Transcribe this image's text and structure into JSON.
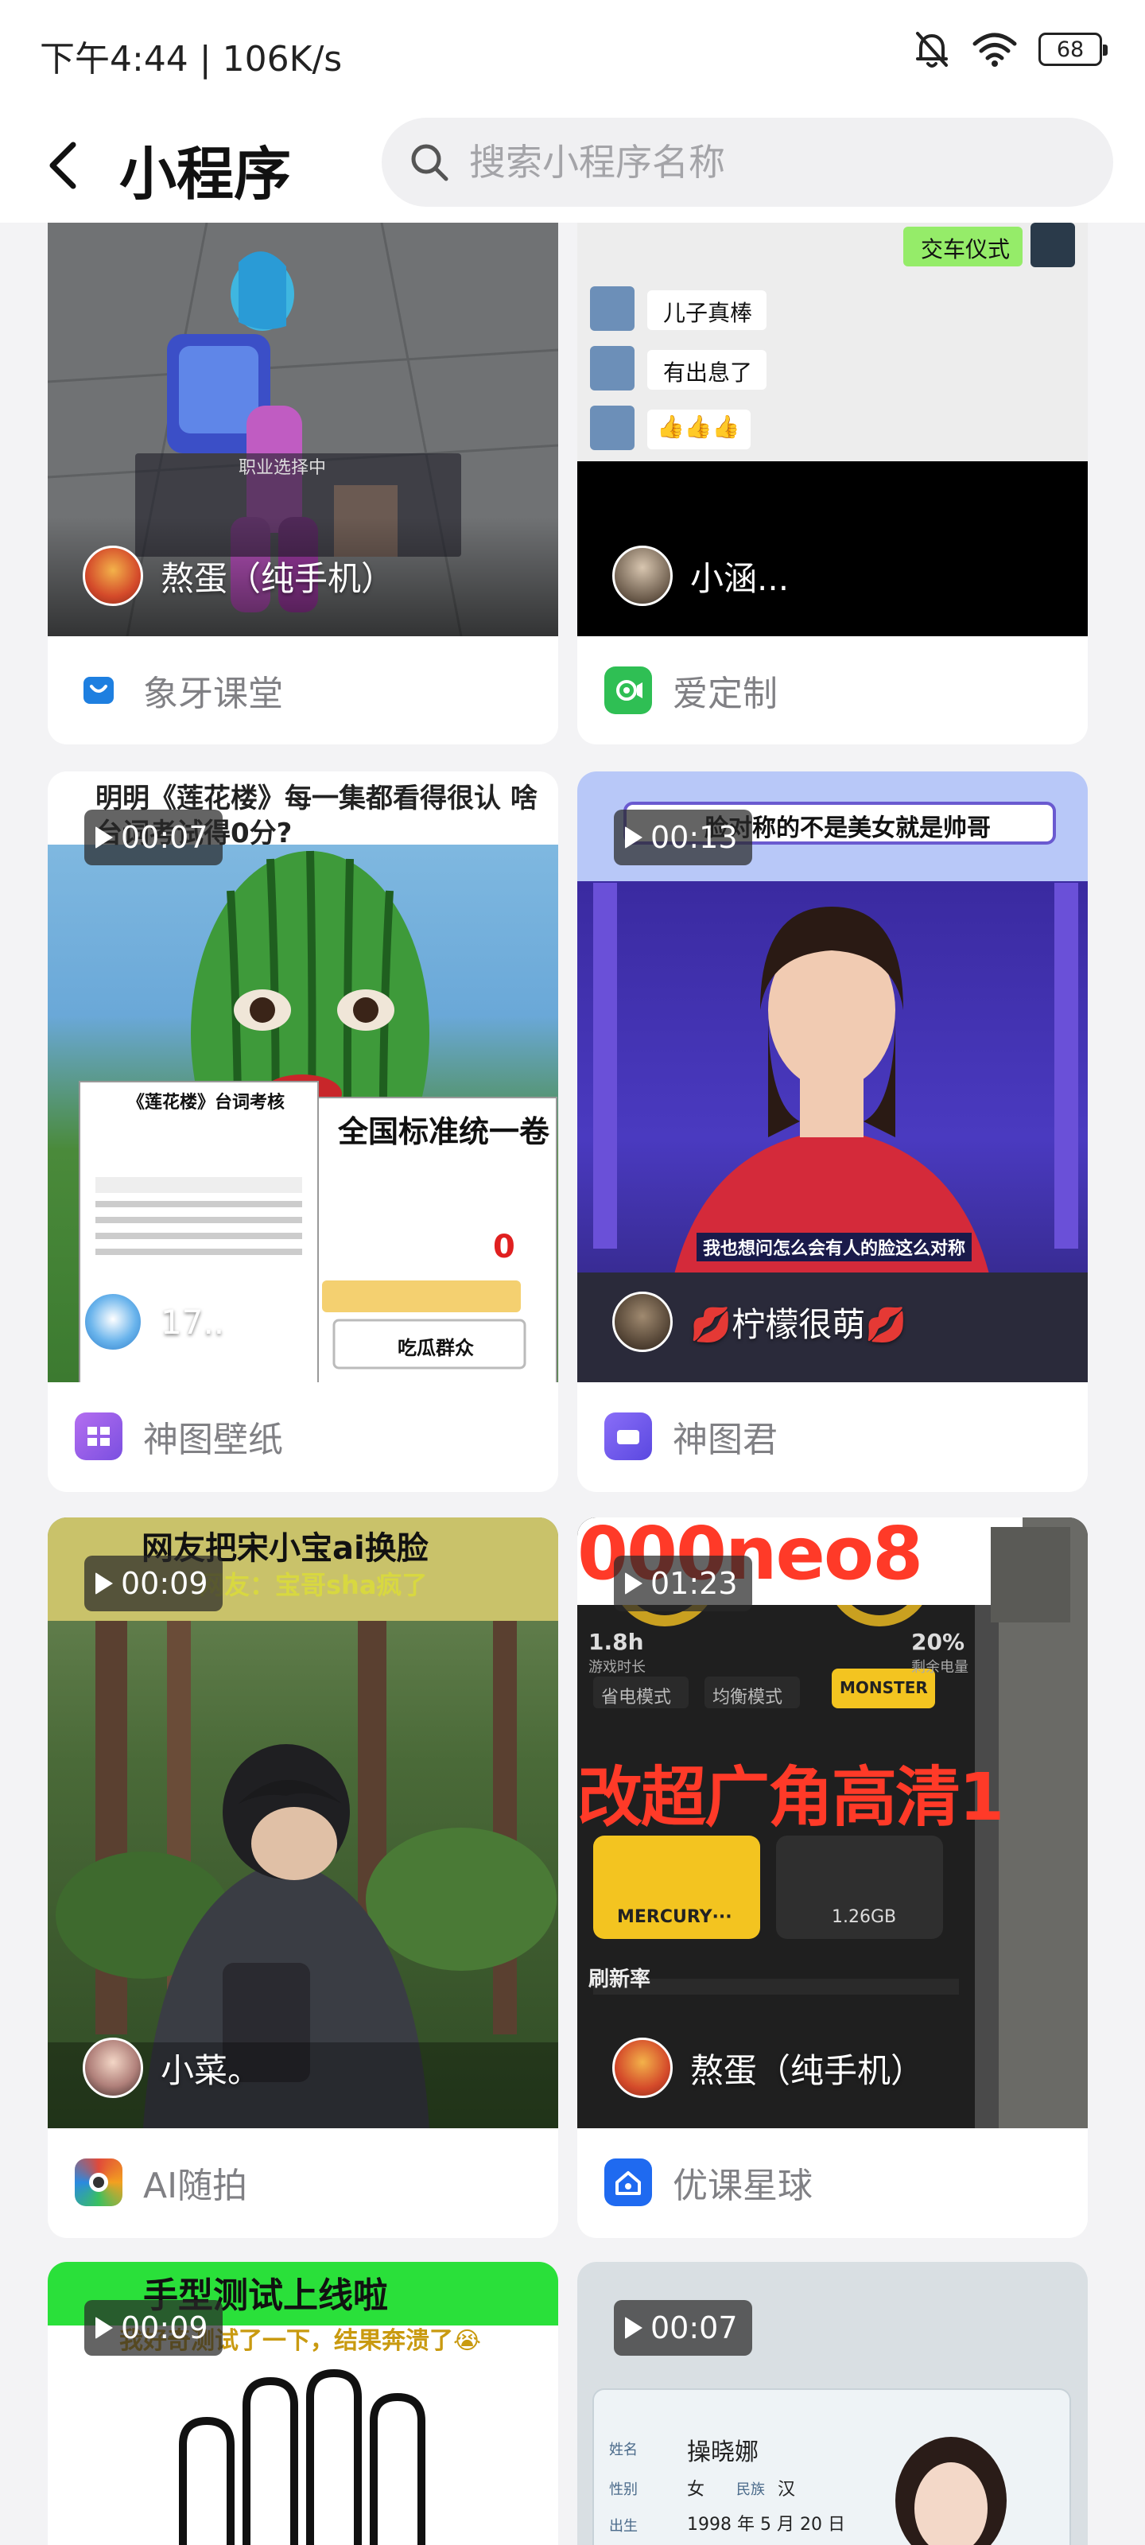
{
  "status_bar": {
    "time": "下午4:44 | 106K/s",
    "battery": "68"
  },
  "header": {
    "title": "小程序",
    "search_placeholder": "搜索小程序名称"
  },
  "cards": [
    {
      "author": "熬蛋（纯手机）",
      "app": "象牙课堂",
      "duration": "",
      "caption": "职业选择中"
    },
    {
      "author": "小涵...",
      "app": "爱定制",
      "duration": "",
      "caption": ""
    },
    {
      "author": "17..",
      "app": "神图壁纸",
      "duration": "00:07",
      "caption": "明明《莲花楼》每一集都看得很认 啥台词考试得0分?"
    },
    {
      "author": "💋柠檬很萌💋",
      "app": "神图君",
      "duration": "00:13",
      "caption": "脸对称的不是美女就是帅哥"
    },
    {
      "author": "小菜。",
      "app": "AI随拍",
      "duration": "00:09",
      "caption": "网友把宋小宝ai换脸"
    },
    {
      "author": "熬蛋（纯手机）",
      "app": "优课星球",
      "duration": "01:23",
      "caption": "000neo8"
    },
    {
      "author": "",
      "app": "",
      "duration": "00:09",
      "caption": "手型测试上线啦"
    },
    {
      "author": "",
      "app": "",
      "duration": "00:07",
      "caption": ""
    }
  ],
  "chat_snippets": [
    "交车仪式",
    "儿子真棒",
    "有出息了",
    "👍👍👍"
  ],
  "image_texts": {
    "card3_banner": "全国标准统一卷",
    "card3_doc": "《莲花楼》台词考核",
    "card3_score": "0",
    "card3_sticker": "吃瓜群众",
    "card4_subtitle": "我也想问怎么会有人的脸这么对称",
    "card5_sub": "网友：宝哥sha疯了",
    "card6_big": "改超广角高清1",
    "card6_wifi": "MERCURY···",
    "card6_data": "1.26GB",
    "card6_refresh": "刷新率",
    "card6_stat1": "1.8h",
    "card6_stat1_label": "游戏时长",
    "card6_stat2": "20%",
    "card6_stat2_label": "剩余电量",
    "card6_mode1": "省电模式",
    "card6_mode2": "均衡模式",
    "card6_mode3": "MONSTER",
    "card7_sub": "我好奇测试了一下，结果奔溃了😭",
    "card8_name_label": "姓名",
    "card8_name": "操晓娜",
    "card8_gender_label": "性别",
    "card8_gender": "女",
    "card8_ethnic_label": "民族",
    "card8_ethnic": "汉",
    "card8_birth_label": "出生",
    "card8_birth": "1998 年 5 月 20 日"
  },
  "colors": {
    "page_bg": "#f3f3f5",
    "card_bg": "#ffffff",
    "muted_text": "#808084",
    "search_bg": "#f0f0f2"
  }
}
